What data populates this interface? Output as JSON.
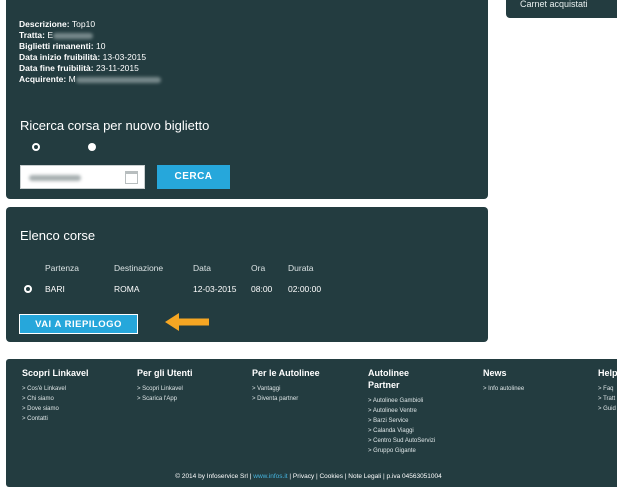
{
  "sidebar": {
    "carnet_link": "Carnet acquistati"
  },
  "info": {
    "descrizione_label": "Descrizione:",
    "descrizione_value": "Top10",
    "tratta_label": "Tratta:",
    "tratta_value": "E",
    "biglietti_label": "Biglietti rimanenti:",
    "biglietti_value": "10",
    "inizio_label": "Data inizio fruibilità:",
    "inizio_value": "13-03-2015",
    "fine_label": "Data fine fruibilità:",
    "fine_value": "23-11-2015",
    "acquirente_label": "Acquirente:",
    "acquirente_value": "M"
  },
  "ricerca": {
    "title": "Ricerca corsa per nuovo biglietto",
    "cerca_label": "CERCA"
  },
  "elenco": {
    "title": "Elenco corse",
    "headers": {
      "partenza": "Partenza",
      "destinazione": "Destinazione",
      "data": "Data",
      "ora": "Ora",
      "durata": "Durata"
    },
    "row": {
      "partenza": "BARI",
      "destinazione": "ROMA",
      "data": "12-03-2015",
      "ora": "08:00",
      "durata": "02:00:00"
    },
    "riepilogo_label": "VAI A RIEPILOGO"
  },
  "footer": {
    "col1": {
      "title": "Scopri Linkavel",
      "items": [
        "> Cos'è Linkavel",
        "> Chi siamo",
        "> Dove siamo",
        "> Contatti"
      ]
    },
    "col2": {
      "title": "Per gli Utenti",
      "items": [
        "> Scopri Linkavel",
        "> Scarica l'App"
      ]
    },
    "col3": {
      "title": "Per le Autolinee",
      "items": [
        "> Vantaggi",
        "> Diventa partner"
      ]
    },
    "col4": {
      "title": "Autolinee Partner",
      "items": [
        "> Autolinee Gambioli",
        "> Autolinee Ventre",
        "> Barzi Service",
        "> Calanda Viaggi",
        "> Centro Sud AutoServizi",
        "> Gruppo Gigante"
      ]
    },
    "col5": {
      "title": "News",
      "items": [
        "> Info autolinee"
      ]
    },
    "col6": {
      "title": "Help",
      "items": [
        "> Faq",
        "> Tratt",
        "> Guid"
      ]
    },
    "copyright_pre": "© 2014 by Infoservice Srl | ",
    "copyright_link": "www.infos.it",
    "copyright_post": " | Privacy | Cookies | Note Legali | p.iva 04563051004"
  },
  "colors": {
    "panel": "#233c40",
    "accent": "#26a7db",
    "arrow": "#f5a623"
  },
  "icons": [
    "calendar-icon",
    "arrow-left-icon"
  ]
}
